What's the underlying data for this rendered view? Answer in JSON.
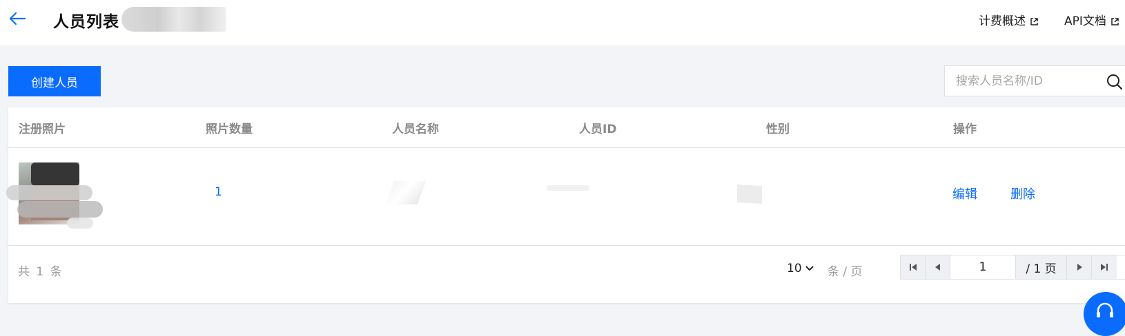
{
  "header": {
    "back_icon": "arrow-left-icon",
    "title": "人员列表",
    "links": [
      {
        "label": "计费概述",
        "icon": "external-link-icon"
      },
      {
        "label": "API文档",
        "icon": "external-link-icon"
      }
    ]
  },
  "toolbar": {
    "create_label": "创建人员",
    "search_placeholder": "搜索人员名称/ID",
    "search_icon": "search-icon"
  },
  "table": {
    "columns": [
      "注册照片",
      "照片数量",
      "人员名称",
      "人员ID",
      "性别",
      "操作"
    ],
    "rows": [
      {
        "photo_count": "1",
        "actions": [
          "编辑",
          "删除"
        ]
      }
    ]
  },
  "pagination": {
    "total_text": "共 1 条",
    "page_size": "10",
    "per_page_label": "条 / 页",
    "current_page": "1",
    "total_pages": "/ 1 页"
  },
  "colors": {
    "primary": "#0a6cff",
    "background": "#f2f4f8"
  }
}
